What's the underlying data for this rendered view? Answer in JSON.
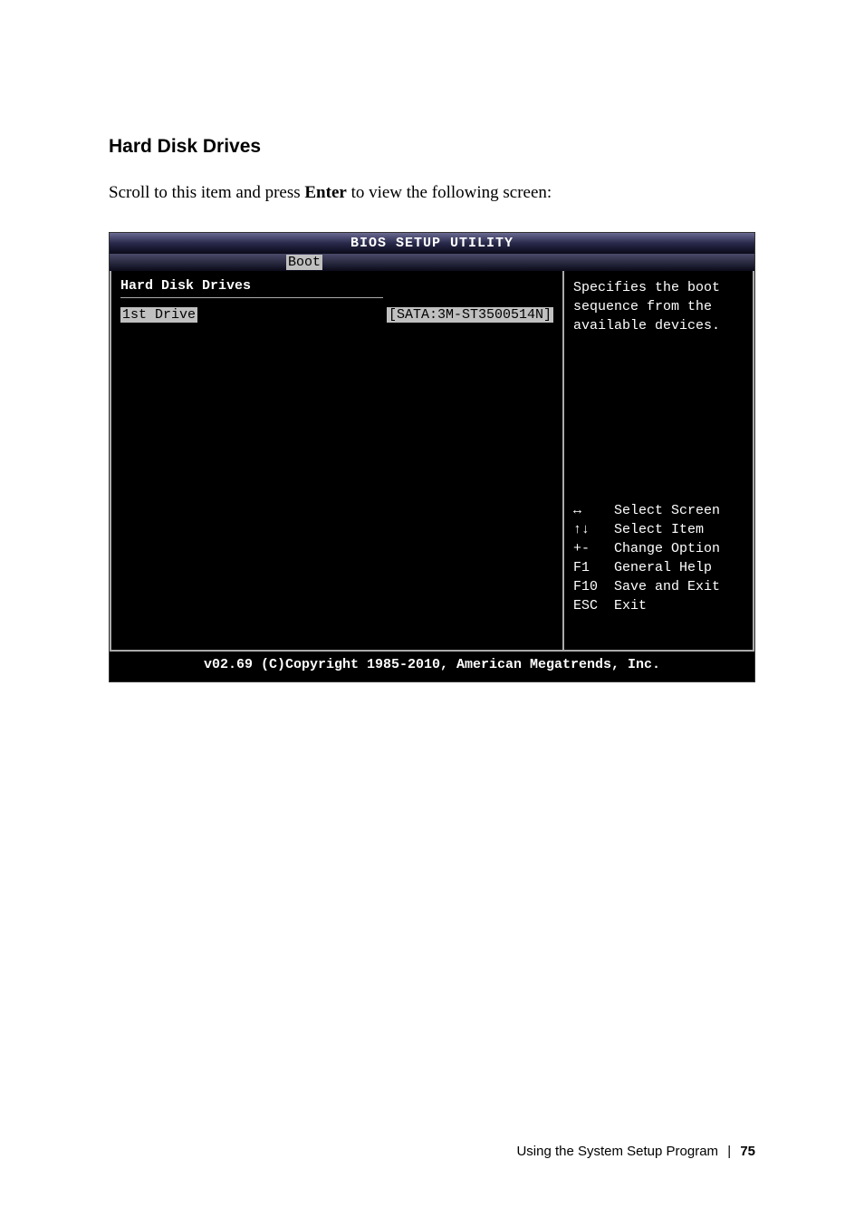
{
  "section": {
    "heading": "Hard Disk Drives",
    "instruction_prefix": "Scroll to this item and press ",
    "instruction_bold": "Enter",
    "instruction_suffix": " to view the following screen:"
  },
  "bios": {
    "title": "BIOS SETUP UTILITY",
    "tab": "Boot",
    "left_panel": {
      "title": "Hard Disk Drives",
      "item_label": "1st Drive",
      "item_value": "[SATA:3M-ST3500514N]"
    },
    "right_panel": {
      "help_line1": "Specifies the boot",
      "help_line2": "sequence from the",
      "help_line3": "available devices.",
      "legend": [
        {
          "key": "↔",
          "desc": "Select Screen"
        },
        {
          "key": "↑↓",
          "desc": "Select Item"
        },
        {
          "key": "+-",
          "desc": "Change Option"
        },
        {
          "key": "F1",
          "desc": "General Help"
        },
        {
          "key": "F10",
          "desc": "Save and Exit"
        },
        {
          "key": "ESC",
          "desc": "Exit"
        }
      ]
    },
    "footer": "v02.69 (C)Copyright 1985-2010, American Megatrends, Inc."
  },
  "page_footer": {
    "text": "Using the System Setup Program",
    "divider": "|",
    "page": "75"
  }
}
